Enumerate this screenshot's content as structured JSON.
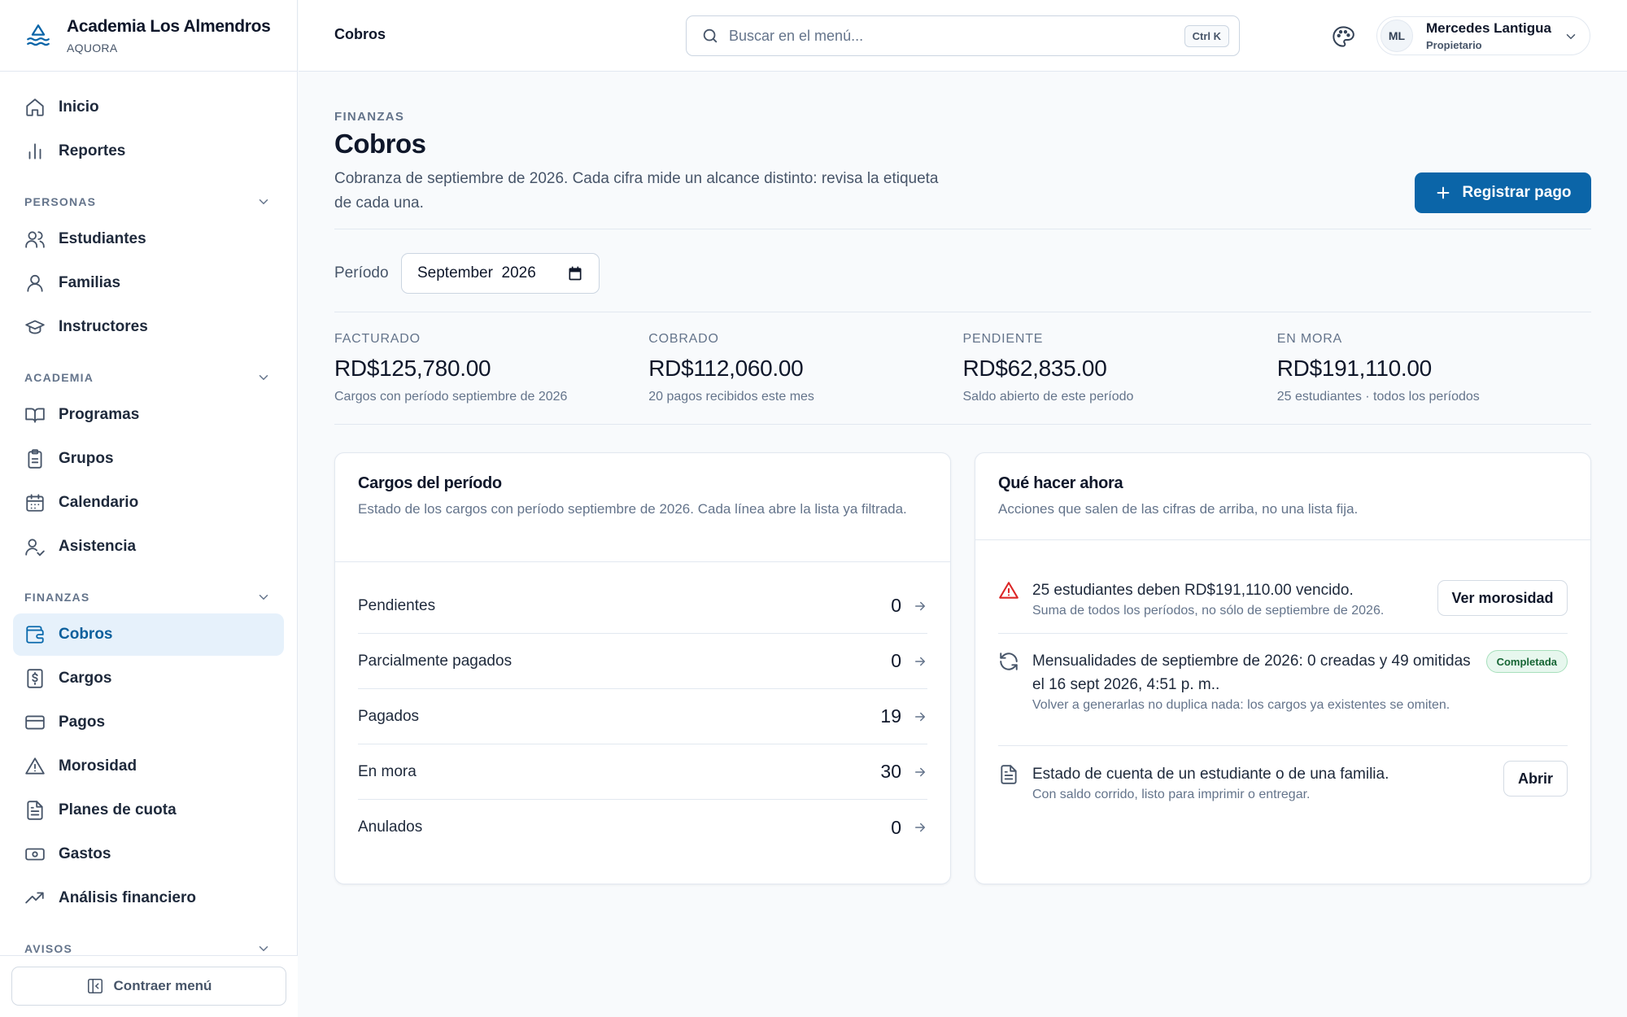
{
  "brand": {
    "name": "Academia Los Almendros",
    "sub": "AQUORA"
  },
  "sidebar": {
    "top_items": [
      {
        "label": "Inicio",
        "icon": "home-icon"
      },
      {
        "label": "Reportes",
        "icon": "bar-chart-icon"
      }
    ],
    "sections": [
      {
        "title": "PERSONAS",
        "items": [
          {
            "label": "Estudiantes",
            "icon": "users-icon"
          },
          {
            "label": "Familias",
            "icon": "user-icon"
          },
          {
            "label": "Instructores",
            "icon": "graduation-cap-icon"
          }
        ]
      },
      {
        "title": "ACADEMIA",
        "items": [
          {
            "label": "Programas",
            "icon": "book-icon"
          },
          {
            "label": "Grupos",
            "icon": "clipboard-icon"
          },
          {
            "label": "Calendario",
            "icon": "calendar-icon"
          },
          {
            "label": "Asistencia",
            "icon": "user-check-icon"
          }
        ]
      },
      {
        "title": "FINANZAS",
        "items": [
          {
            "label": "Cobros",
            "icon": "wallet-icon",
            "active": true
          },
          {
            "label": "Cargos",
            "icon": "receipt-icon"
          },
          {
            "label": "Pagos",
            "icon": "credit-card-icon"
          },
          {
            "label": "Morosidad",
            "icon": "warning-icon"
          },
          {
            "label": "Planes de cuota",
            "icon": "file-text-icon"
          },
          {
            "label": "Gastos",
            "icon": "banknote-icon"
          },
          {
            "label": "Análisis financiero",
            "icon": "trending-up-icon"
          }
        ]
      },
      {
        "title": "AVISOS",
        "items": []
      }
    ],
    "collapse_label": "Contraer menú"
  },
  "topbar": {
    "breadcrumb": "Cobros",
    "search_placeholder": "Buscar en el menú...",
    "shortcut": "Ctrl K",
    "user": {
      "initials": "ML",
      "name": "Mercedes Lantigua",
      "role": "Propietario"
    }
  },
  "header": {
    "eyebrow": "FINANZAS",
    "title": "Cobros",
    "lead": "Cobranza de septiembre de 2026. Cada cifra mide un alcance distinto: revisa la etiqueta de cada una.",
    "primary_button": "Registrar pago"
  },
  "period": {
    "label": "Período",
    "value": "September  2026"
  },
  "kpis": [
    {
      "label": "FACTURADO",
      "value": "RD$125,780.00",
      "note": "Cargos con período septiembre de 2026"
    },
    {
      "label": "COBRADO",
      "value": "RD$112,060.00",
      "note": "20 pagos recibidos este mes"
    },
    {
      "label": "PENDIENTE",
      "value": "RD$62,835.00",
      "note": "Saldo abierto de este período"
    },
    {
      "label": "EN MORA",
      "value": "RD$191,110.00",
      "note": "25 estudiantes · todos los períodos"
    }
  ],
  "charges_card": {
    "title": "Cargos del período",
    "desc": "Estado de los cargos con período septiembre de 2026. Cada línea abre la lista ya filtrada.",
    "rows": [
      {
        "label": "Pendientes",
        "count": "0"
      },
      {
        "label": "Parcialmente pagados",
        "count": "0"
      },
      {
        "label": "Pagados",
        "count": "19"
      },
      {
        "label": "En mora",
        "count": "30"
      },
      {
        "label": "Anulados",
        "count": "0"
      }
    ]
  },
  "actions_card": {
    "title": "Qué hacer ahora",
    "desc": "Acciones que salen de las cifras de arriba, no una lista fija.",
    "items": [
      {
        "icon": "alert-triangle-icon",
        "title": "25 estudiantes deben RD$191,110.00 vencido.",
        "sub": "Suma de todos los períodos, no sólo de septiembre de 2026.",
        "button": "Ver morosidad"
      },
      {
        "icon": "refresh-icon",
        "title": "Mensualidades de septiembre de 2026: 0 creadas y 49 omitidas el 16 sept 2026, 4:51 p. m..",
        "sub": "Volver a generarlas no duplica nada: los cargos ya existentes se omiten.",
        "badge": "Completada"
      },
      {
        "icon": "document-icon",
        "title": "Estado de cuenta de un estudiante o de una familia.",
        "sub": "Con saldo corrido, listo para imprimir o entregar.",
        "button": "Abrir"
      }
    ]
  },
  "colors": {
    "accent": "#0b65a8",
    "active_bg": "#e6f1fb",
    "danger": "#dc2626",
    "success": "#166534"
  }
}
